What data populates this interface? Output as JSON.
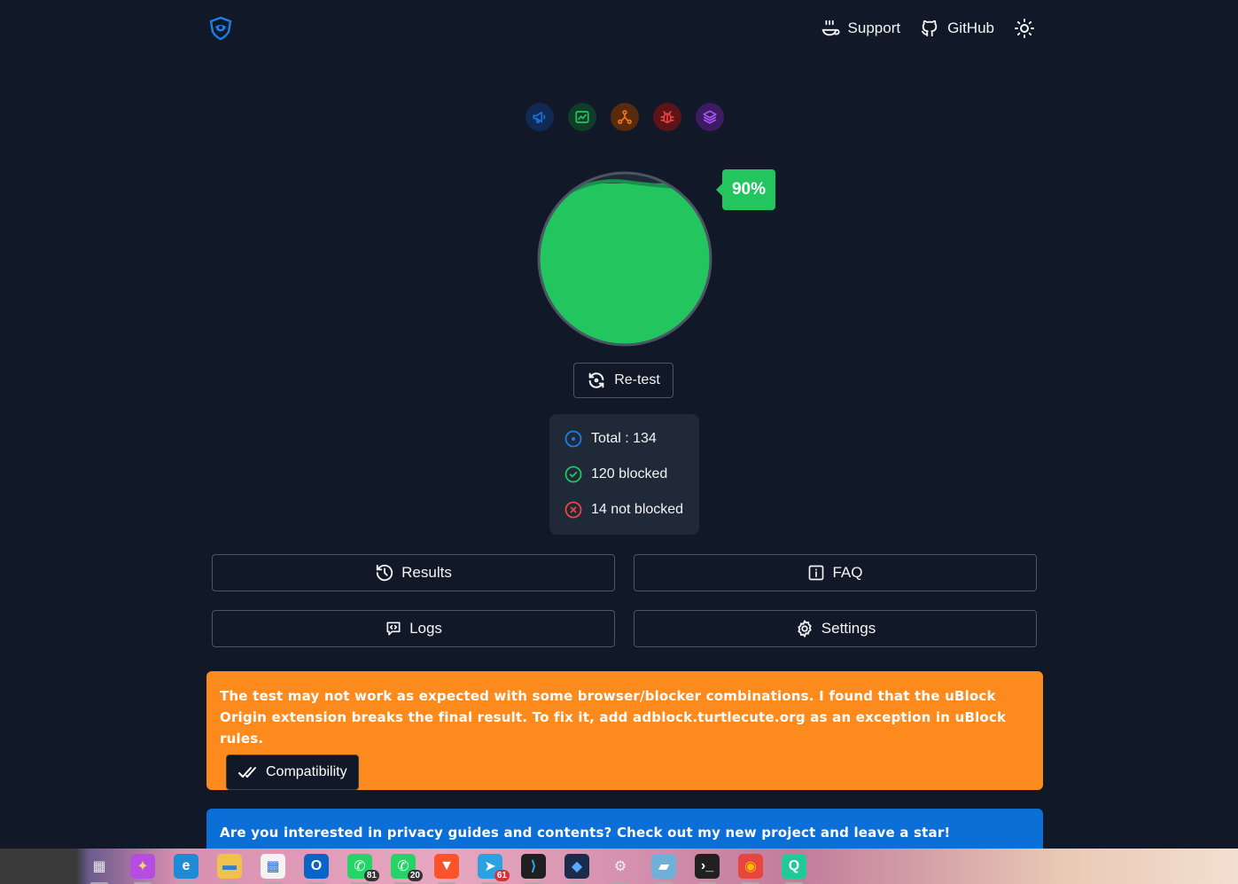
{
  "header": {
    "logo_icon": "shield-logo-icon",
    "support_label": "Support",
    "github_label": "GitHub",
    "theme_icon": "sun-icon"
  },
  "categories": [
    {
      "icon": "megaphone-icon",
      "name": "ads",
      "color": "#1e6fd9"
    },
    {
      "icon": "chart-icon",
      "name": "analytics",
      "color": "#22c55e"
    },
    {
      "icon": "network-icon",
      "name": "social",
      "color": "#f97316"
    },
    {
      "icon": "bug-icon",
      "name": "error-trackers",
      "color": "#ef4444"
    },
    {
      "icon": "layers-icon",
      "name": "mix",
      "color": "#a855f7"
    }
  ],
  "score": {
    "percent_label": "90%",
    "fill_fraction": 0.9,
    "color": "#22c55e"
  },
  "retest_label": "Re-test",
  "stats": {
    "total": "Total : 134",
    "blocked": "120 blocked",
    "not_blocked": "14 not blocked"
  },
  "buttons": {
    "results": "Results",
    "faq": "FAQ",
    "logs": "Logs",
    "settings": "Settings"
  },
  "warning": {
    "text": "The test may not work as expected with some browser/blocker combinations. I found that the uBlock Origin extension breaks the final result. To fix it, add adblock.turtlecute.org as an exception in uBlock rules.",
    "button_label": "Compatibility",
    "color": "#fd8a1d"
  },
  "promo": {
    "text": "Are you interested in privacy guides and contents? Check out my new project and leave a star!",
    "color": "#0c6fd8"
  },
  "taskbar": {
    "apps": [
      {
        "name": "task-view-icon"
      },
      {
        "name": "copilot-icon"
      },
      {
        "name": "edge-icon"
      },
      {
        "name": "file-explorer-icon"
      },
      {
        "name": "microsoft-store-icon"
      },
      {
        "name": "outlook-icon"
      },
      {
        "name": "whatsapp-icon",
        "badge": "81"
      },
      {
        "name": "whatsapp-business-icon",
        "badge": "20"
      },
      {
        "name": "brave-icon"
      },
      {
        "name": "telegram-icon",
        "badge": "61"
      },
      {
        "name": "vscode-icon"
      },
      {
        "name": "app-icon"
      },
      {
        "name": "settings-icon"
      },
      {
        "name": "notes-icon"
      },
      {
        "name": "terminal-icon"
      },
      {
        "name": "chrome-icon"
      },
      {
        "name": "search-app-icon"
      }
    ]
  }
}
